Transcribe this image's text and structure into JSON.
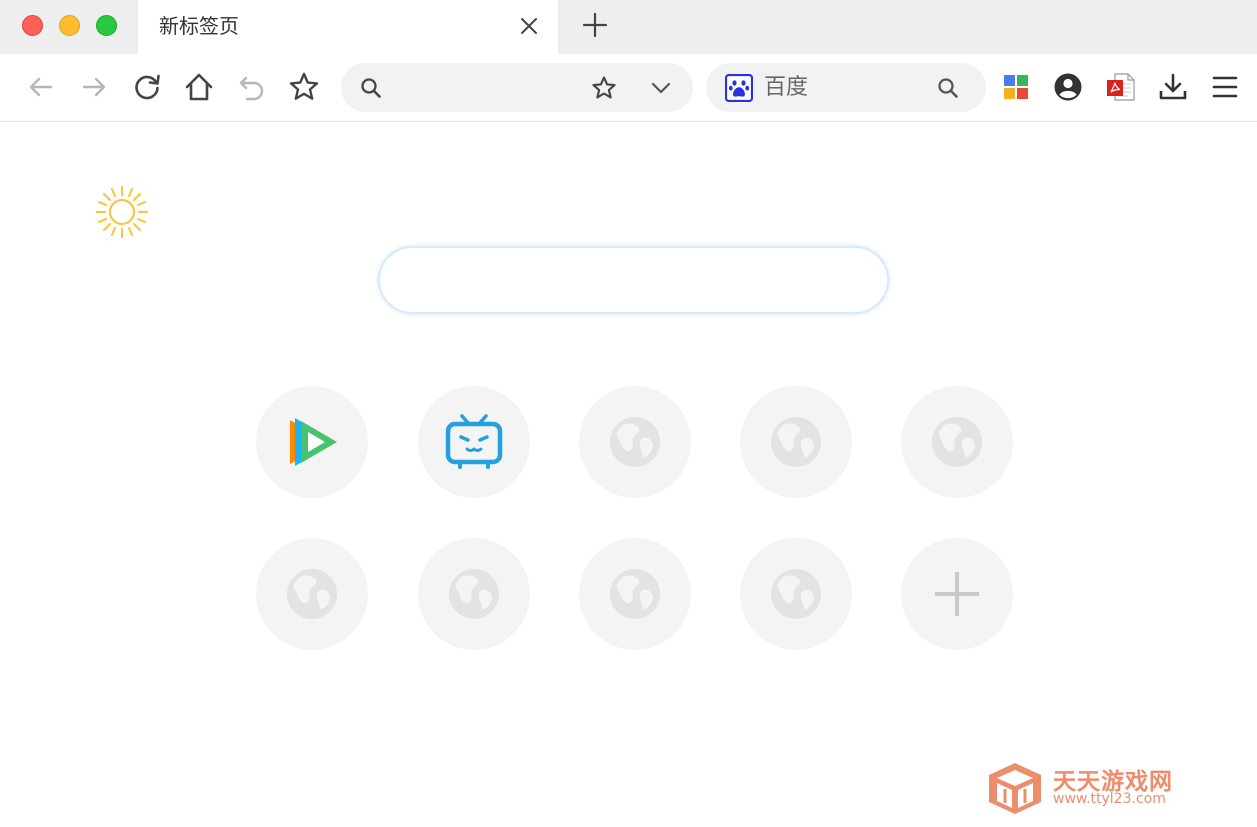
{
  "window": {
    "tab": {
      "title": "新标签页"
    }
  },
  "toolbar": {
    "address_bar": {
      "value": "",
      "placeholder": ""
    },
    "search_engine": {
      "name": "百度",
      "icon": "baidu-paw-icon"
    },
    "extensions": [
      "apps-grid-icon",
      "account-icon",
      "pdf-icon",
      "download-icon",
      "menu-icon"
    ]
  },
  "content": {
    "weather_icon": "sun-icon",
    "search": {
      "value": "",
      "placeholder": ""
    },
    "speed_dial": [
      {
        "icon": "tencent-video-icon"
      },
      {
        "icon": "bilibili-icon"
      },
      {
        "icon": "globe-icon"
      },
      {
        "icon": "globe-icon"
      },
      {
        "icon": "globe-icon"
      },
      {
        "icon": "globe-icon"
      },
      {
        "icon": "globe-icon"
      },
      {
        "icon": "globe-icon"
      },
      {
        "icon": "globe-icon"
      },
      {
        "icon": "plus-icon"
      }
    ]
  },
  "watermark": {
    "title": "天天游戏网",
    "url": "www.ttyl23.com"
  },
  "colors": {
    "tabstrip_bg": "#eeeeee",
    "omnibox_bg": "#f1f2f4",
    "tile_bg": "#f4f4f4",
    "sun": "#f5c842",
    "watermark": "#ec8d6b"
  }
}
